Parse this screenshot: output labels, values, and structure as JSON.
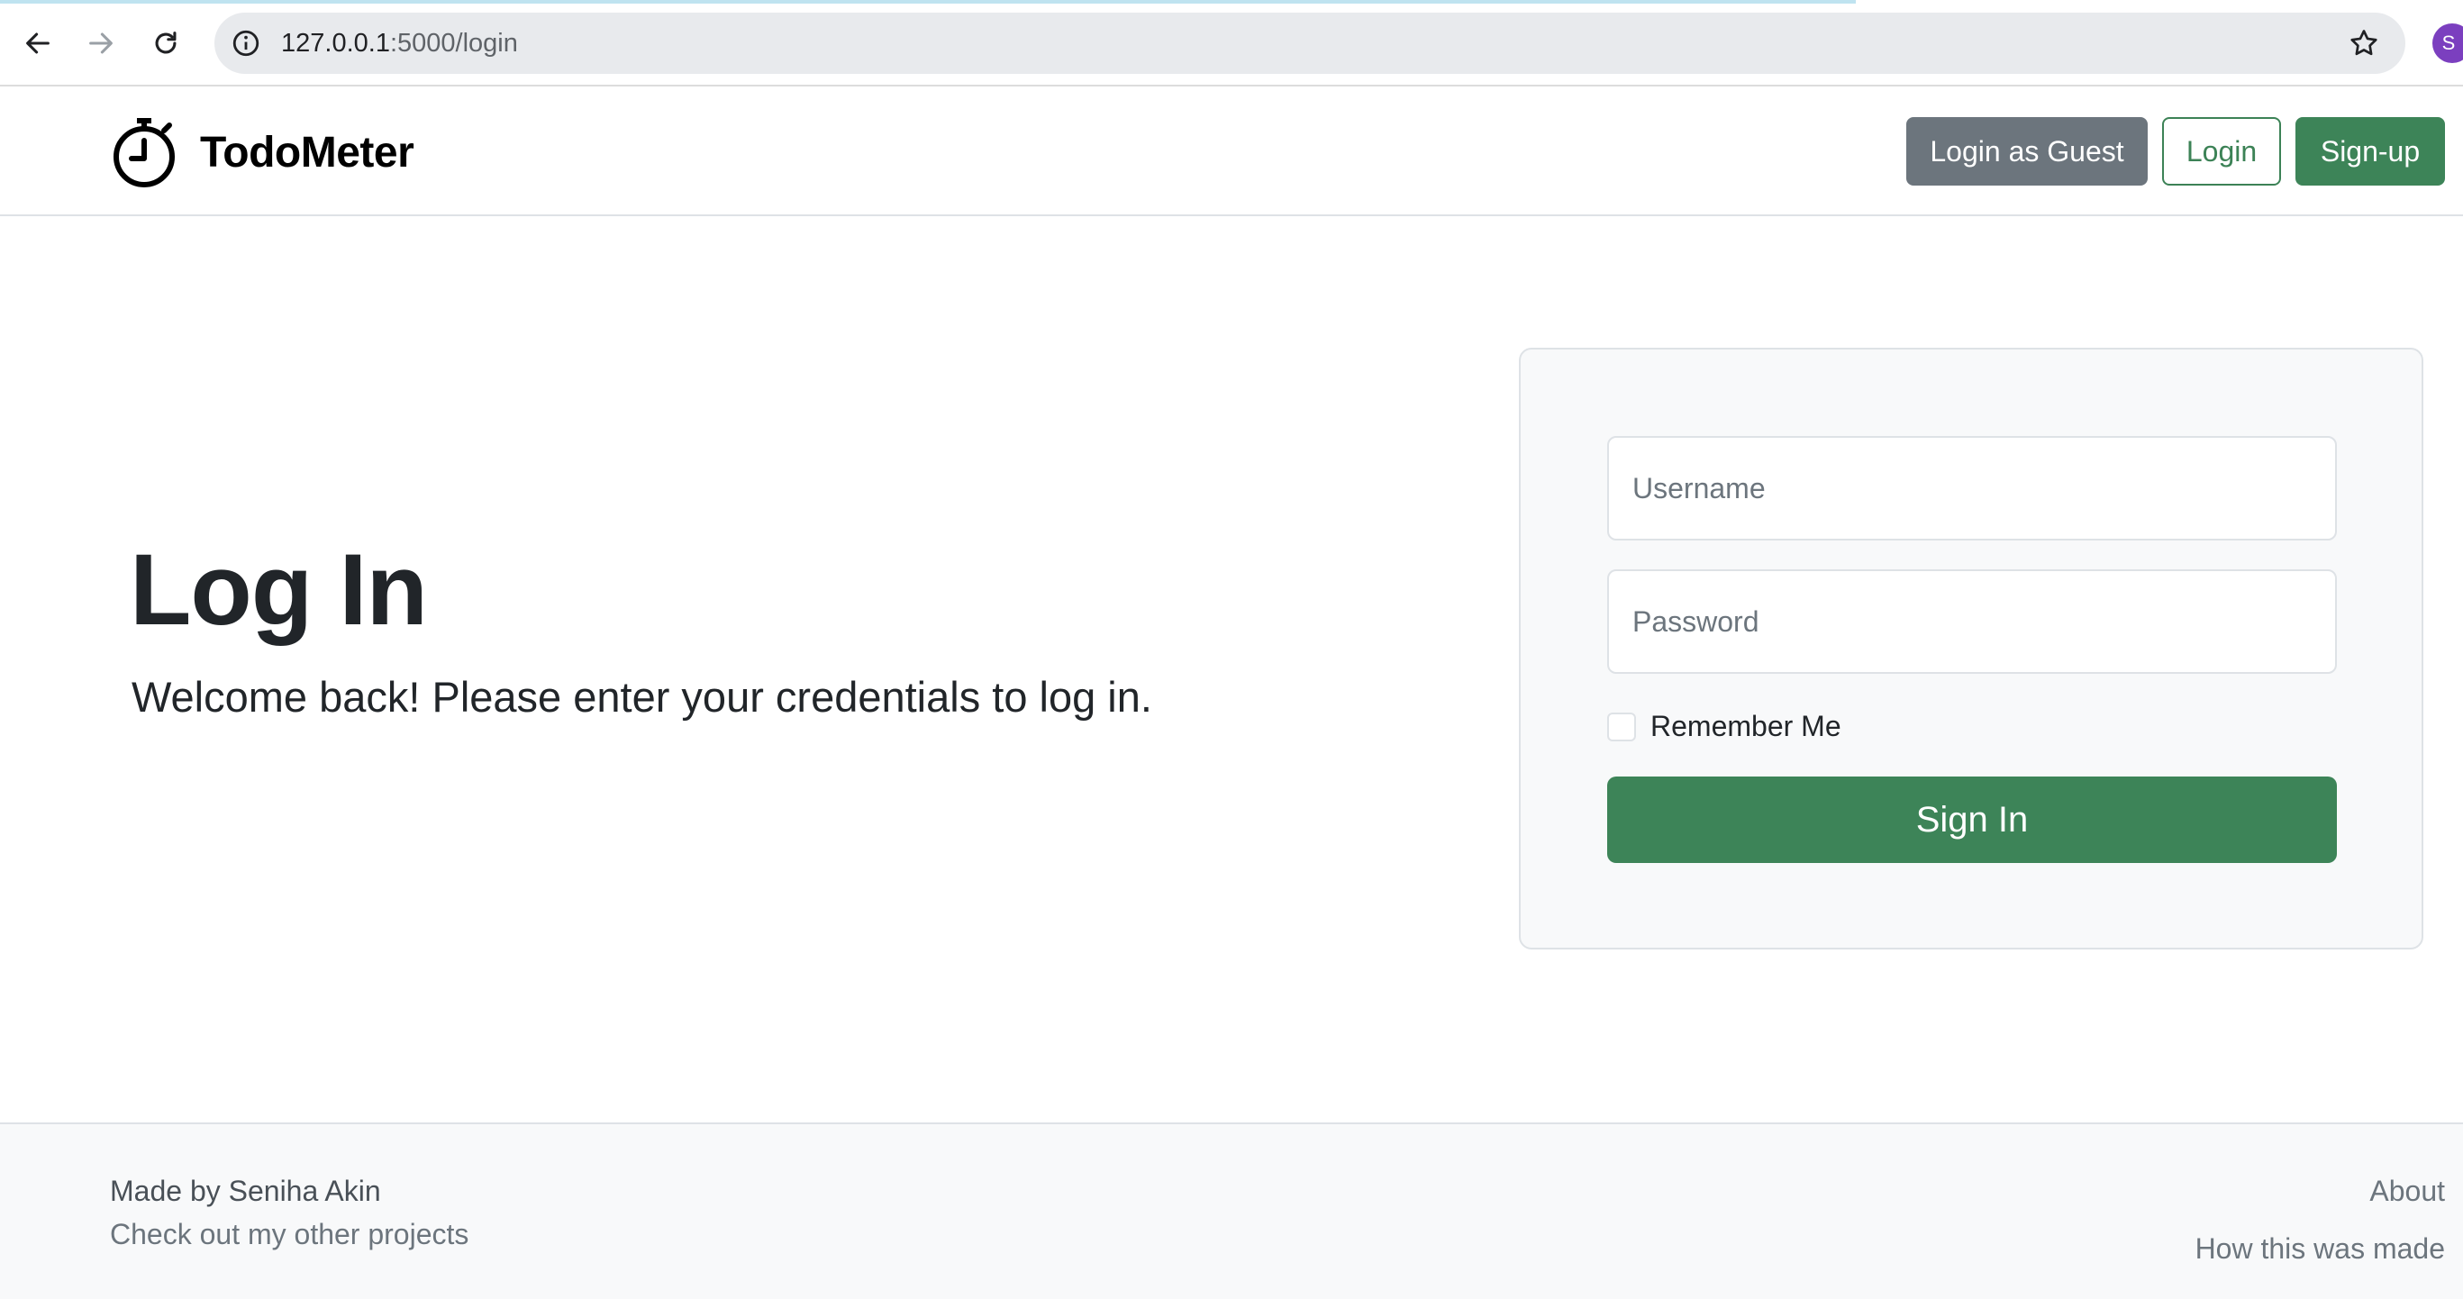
{
  "browser": {
    "url_host": "127.0.0.1",
    "url_rest": ":5000/login",
    "profile_initial": "S"
  },
  "navbar": {
    "brand": "TodoMeter",
    "guest_label": "Login as Guest",
    "login_label": "Login",
    "signup_label": "Sign-up"
  },
  "hero": {
    "title": "Log In",
    "subtitle": "Welcome back! Please enter your credentials to log in."
  },
  "form": {
    "username_placeholder": "Username",
    "password_placeholder": "Password",
    "remember_label": "Remember Me",
    "submit_label": "Sign In"
  },
  "footer": {
    "made_by": "Made by Seniha Akin",
    "other_projects": "Check out my other projects",
    "about": "About",
    "how_made": "How this was made"
  },
  "colors": {
    "primary_green": "#3d8458",
    "secondary_gray": "#6c757d",
    "card_bg": "#f8f9fa"
  }
}
